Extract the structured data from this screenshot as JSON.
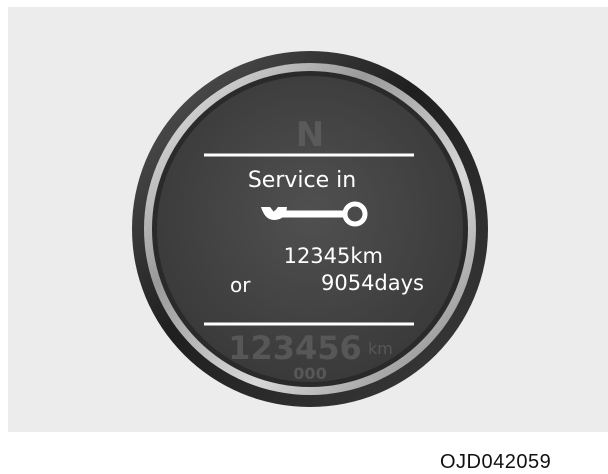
{
  "display": {
    "background_letter": "N",
    "title": "Service in",
    "distance": "12345km",
    "conjunction": "or",
    "days": "9054days",
    "odometer_value": "123456",
    "odometer_unit": "km",
    "trip_value": "000",
    "icon": "wrench-icon"
  },
  "caption": "OJD042059",
  "colors": {
    "frame": "#ececec",
    "bezel_dark": "#2b2b2b",
    "bezel_silver": "#c9c9c9",
    "screen": "#474747",
    "text": "#ffffff",
    "faded_text": "#5a5a5a"
  }
}
